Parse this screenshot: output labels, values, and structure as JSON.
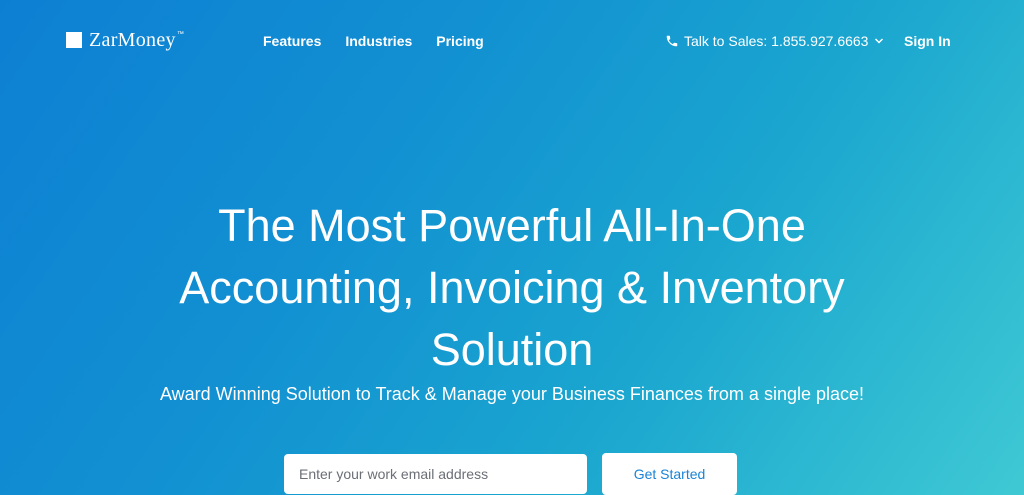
{
  "brand": {
    "name": "ZarMoney",
    "trademark": "™"
  },
  "nav": {
    "links": [
      {
        "label": "Features"
      },
      {
        "label": "Industries"
      },
      {
        "label": "Pricing"
      }
    ],
    "sales": {
      "label": "Talk to Sales: 1.855.927.6663",
      "icon": "phone-icon",
      "caret": "chevron-down-icon"
    },
    "sign_in": "Sign In"
  },
  "hero": {
    "title_lines": [
      "The Most Powerful All-In-One",
      "Accounting, Invoicing & Inventory",
      "Solution"
    ],
    "subtitle": "Award Winning Solution to Track & Manage your Business Finances from a single place!",
    "email": {
      "placeholder": "Enter your work email address",
      "value": ""
    },
    "cta": "Get Started"
  },
  "colors": {
    "gradient_start": "#0d7fd3",
    "gradient_end": "#3fc9d4",
    "cta_text": "#1a84d6"
  }
}
